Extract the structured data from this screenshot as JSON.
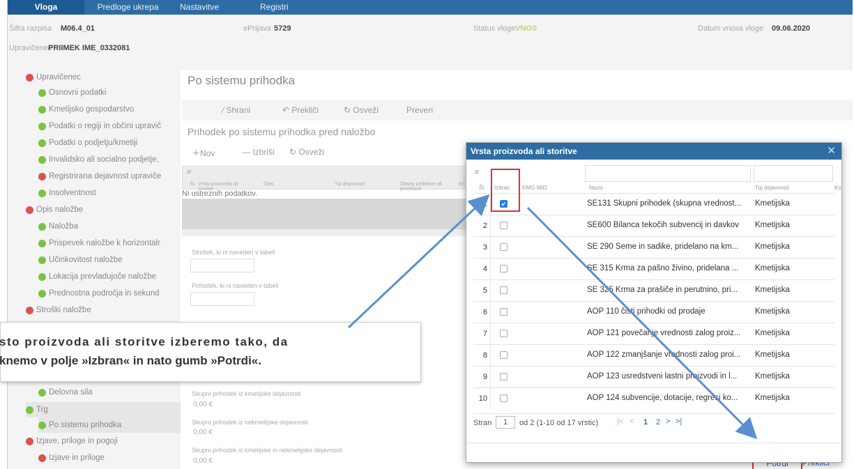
{
  "nav": {
    "tabs": [
      "Vloga",
      "Predloge ukrepa",
      "Nastavitve razpisa",
      "Registri"
    ]
  },
  "info": {
    "sifra_label": "Šifra razpisa",
    "sifra_value": "M06.4_01",
    "eprijava_label": "ePrijava",
    "eprijava_value": "5729",
    "status_label": "Status vloge",
    "status_value": "VNOS",
    "datum_label": "Datum vnosa vloge",
    "datum_value": "09.06.2020",
    "upravicenec_label": "Upravičenec",
    "upravicenec_value": "PRIIMEK IME_0332081"
  },
  "sidebar": {
    "items": [
      "Upravičenec",
      "Osnovni podatki",
      "Kmetijsko gospodarstvo",
      "Podatki o regiji in občini upravič",
      "Podatki o podjetju/kmetiji",
      "Invalidsko ali socialno podjetje,",
      "Registrirana dejavnost upraviče",
      "Insolventnost",
      "Opis naložbe",
      "Naložba",
      "Prispevek naložbe k horizontalr",
      "Učinkovitost naložbe",
      "Lokacija prevladujoče naložbe",
      "Prednostna področja in sekund",
      "Stroški naložbe",
      "Delovna sila",
      "Trg",
      "Po sistemu prihodka",
      "Izjave, priloge in pogoji",
      "Izjave in priloge"
    ]
  },
  "main": {
    "title": "Po sistemu prihodka",
    "toolbar": [
      "Shrani",
      "Prekliči",
      "Osveži",
      "Preveri"
    ],
    "subtitle": "Prihodek po sistemu prihodka pred naložbo",
    "subtoolbar": [
      "Nov",
      "Izbriši",
      "Osveži"
    ],
    "grid_headers": [
      "Št",
      "Vrsta proizvoda ali storitve",
      "Opis",
      "Tip dejavnosti",
      "Obseg pridelave ali predelave",
      "En"
    ],
    "grid_empty": "Ni ustreznih podatkov.",
    "field1_label": "Strošek, ki ni naveden v tabeli",
    "field2_label": "Prihodek, ki ni naveden v tabeli",
    "sum1_label": "Skupni prihodek iz kmetijske dejavnosti",
    "sum1_value": "0,00 €",
    "sum2_label": "Skupni prihodek iz nekmetijske dejavnosti",
    "sum2_value": "0,00 €",
    "sum3_label": "Skupni prihodek iz kmetijske in nekmetijske dejavnosti",
    "sum3_value": "0,00 €"
  },
  "note": {
    "line1": "sto proizvoda ali storitve izberemo tako, da",
    "line2": "knemo v polje »Izbran« in nato gumb »Potrdi«."
  },
  "modal": {
    "title": "Vrsta proizvoda ali storitve",
    "headers": [
      "Št",
      "Izbran",
      "KMG-MID",
      "Naziv",
      "Tip dejavnosti",
      "Kol"
    ],
    "rows": [
      {
        "num": "1",
        "checked": true,
        "naziv": "SE131 Skupni prihodek (skupna vrednost...",
        "tip": "Kmetijska"
      },
      {
        "num": "2",
        "checked": false,
        "naziv": "SE600 Bilanca tekočih subvencij in davkov",
        "tip": "Kmetijska"
      },
      {
        "num": "3",
        "checked": false,
        "naziv": "SE 290 Seme in sadike, pridelano na km...",
        "tip": "Kmetijska"
      },
      {
        "num": "4",
        "checked": false,
        "naziv": "SE 315 Krma za pašno živino, pridelana ...",
        "tip": "Kmetijska"
      },
      {
        "num": "5",
        "checked": false,
        "naziv": "SE 325 Krma za prašiče in perutnino, pri...",
        "tip": "Kmetijska"
      },
      {
        "num": "6",
        "checked": false,
        "naziv": "AOP 110 čisti prihodki od prodaje",
        "tip": "Kmetijska"
      },
      {
        "num": "7",
        "checked": false,
        "naziv": "AOP 121 povečanje vrednosti zalog proiz...",
        "tip": "Kmetijska"
      },
      {
        "num": "8",
        "checked": false,
        "naziv": "AOP 122 zmanjšanje vrednosti zalog proi...",
        "tip": "Kmetijska"
      },
      {
        "num": "9",
        "checked": false,
        "naziv": "AOP 123 usredstveni lastni proizvodi in l...",
        "tip": "Kmetijska"
      },
      {
        "num": "10",
        "checked": false,
        "naziv": "AOP 124 subvencije, dotacije, regresi ko...",
        "tip": "Kmetijska"
      }
    ],
    "pager_label": "Stran",
    "pager_page": "1",
    "pager_info": "od 2 (1-10 od 17 vrstic)",
    "pager_pages": [
      "1",
      "2"
    ],
    "confirm": "Potrdi",
    "cancel": "Prekliči"
  },
  "colors": {
    "nav_bg": "#2e6da4",
    "red_highlight": "#e03030",
    "arrow": "#5a8fcf",
    "status_ok": "#7dc243",
    "status_err": "#d9534f"
  }
}
